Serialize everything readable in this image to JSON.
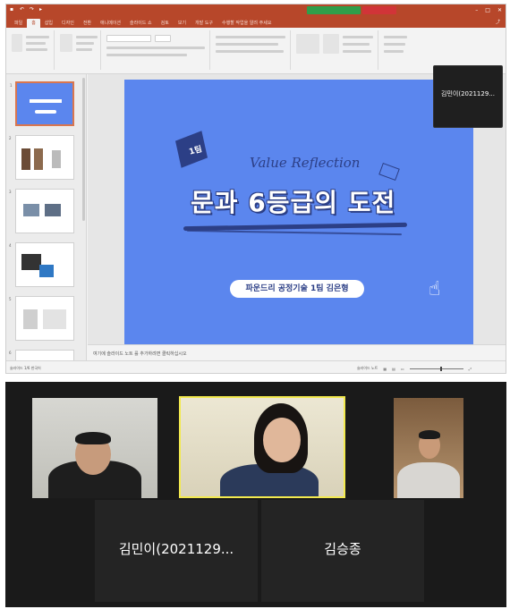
{
  "powerpoint": {
    "tabs": [
      "파일",
      "홈",
      "삽입",
      "디자인",
      "전환",
      "애니메이션",
      "슬라이드 쇼",
      "검토",
      "보기",
      "개발 도구",
      "수행할 작업을 알려 주세요"
    ],
    "active_tab": "홈",
    "colors": {
      "accent": "#b7472a",
      "slide_bg": "#5b86ee",
      "slide_dark": "#2c3f86"
    },
    "slide": {
      "badge": "1팀",
      "subtitle": "Value Reflection",
      "title": "문과 6등급의 도전",
      "presenter_pill": "파운드리 공정기술 1팀 김은형"
    },
    "notes_placeholder": "여기에 슬라이드 노트 를 추가하려면 클릭하십시오",
    "status_left": "슬라이드 1/6 한국어",
    "status_right": "슬라이드 노트",
    "pip": {
      "name": "김민이(2021129..."
    }
  },
  "zoom": {
    "participants": [
      {
        "kind": "video"
      },
      {
        "kind": "video"
      },
      {
        "kind": "video"
      },
      {
        "kind": "name",
        "display": "김민이(2021129..."
      },
      {
        "kind": "name",
        "display": "김승종"
      }
    ]
  }
}
